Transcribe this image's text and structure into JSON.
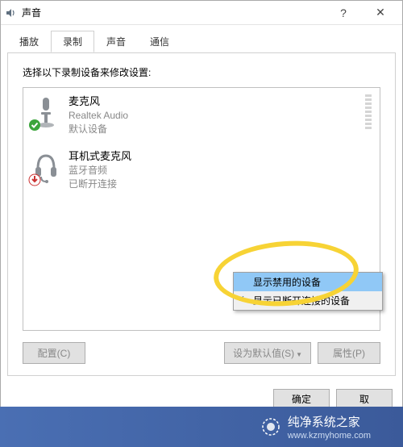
{
  "window": {
    "title": "声音",
    "close_label": "✕",
    "help_label": "?"
  },
  "tabs": {
    "items": [
      {
        "label": "播放"
      },
      {
        "label": "录制"
      },
      {
        "label": "声音"
      },
      {
        "label": "通信"
      }
    ]
  },
  "panel": {
    "instruction": "选择以下录制设备来修改设置:"
  },
  "devices": [
    {
      "title": "麦克风",
      "subtitle": "Realtek Audio",
      "status": "默认设备",
      "icon": "microphone",
      "badge": "check"
    },
    {
      "title": "耳机式麦克风",
      "subtitle": "蓝牙音频",
      "status": "已断开连接",
      "icon": "headset",
      "badge": "disconnected"
    }
  ],
  "context_menu": {
    "items": [
      {
        "label": "显示禁用的设备",
        "checked": false,
        "selected": true
      },
      {
        "label": "显示已断开连接的设备",
        "checked": true,
        "selected": false
      }
    ]
  },
  "buttons": {
    "configure": "配置(C)",
    "set_default": "设为默认值(S)",
    "properties": "属性(P)",
    "ok": "确定",
    "cancel": "取"
  },
  "footer": {
    "brand": "纯净系统之家",
    "url": "www.kzmyhome.com"
  }
}
